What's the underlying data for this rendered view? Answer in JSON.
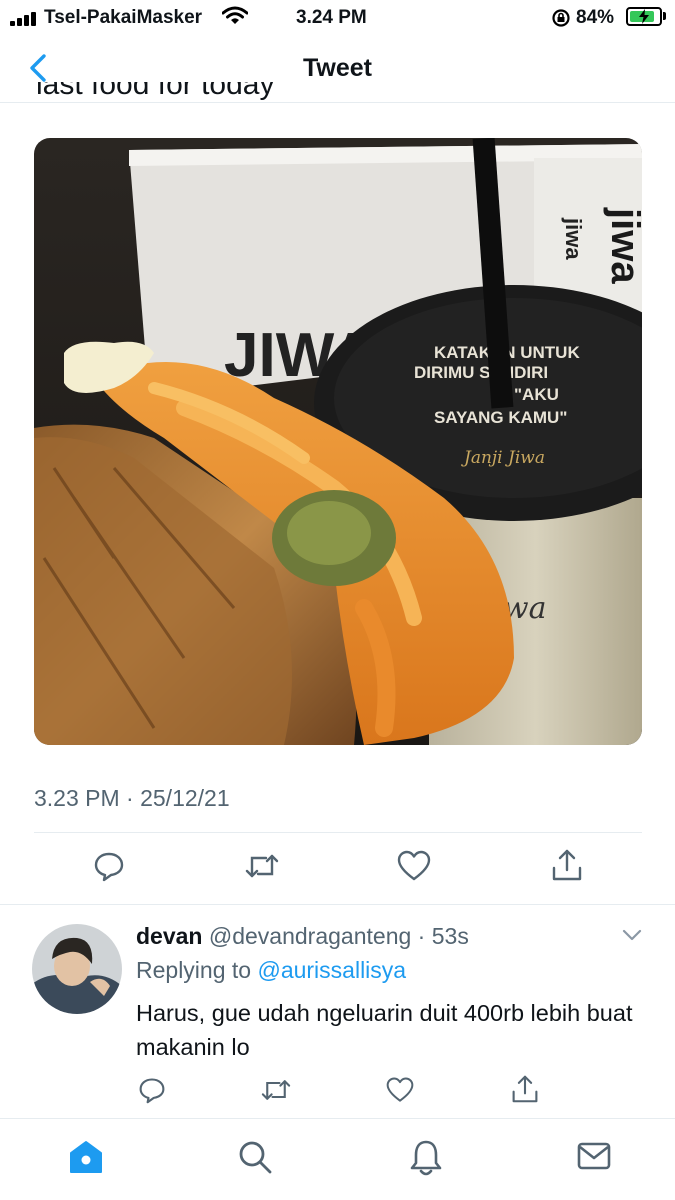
{
  "status_bar": {
    "carrier": "Tsel-PakaiMasker",
    "time": "3.24 PM",
    "battery": "84%",
    "battery_level": 0.84
  },
  "header": {
    "title": "Tweet"
  },
  "tweet": {
    "cut_text": "last food for today",
    "timestamp": "3.23 PM · 25/12/21",
    "photo_lid_text": [
      "KATAKAN UNTUK",
      "DIRIMU SENDIRI",
      "\"AKU",
      "SAYANG KAMU\""
    ],
    "photo_brand": "jiwa",
    "photo_signature": "Janji Jiwa"
  },
  "reply": {
    "name": "devan",
    "handle": "@devandraganteng",
    "time": "53s",
    "replying_prefix": "Replying to ",
    "replying_to": "@aurissallisya",
    "text": "Harus, gue udah ngeluarin duit 400rb lebih buat makanin lo"
  },
  "icons": {
    "reply": "reply-icon",
    "retweet": "retweet-icon",
    "like": "heart-icon",
    "share": "share-icon",
    "home": "home-icon",
    "search": "search-icon",
    "notifications": "bell-icon",
    "messages": "mail-icon"
  },
  "colors": {
    "accent": "#1d9bf0",
    "secondary_text": "#536471",
    "divider": "#e6ecf0"
  }
}
